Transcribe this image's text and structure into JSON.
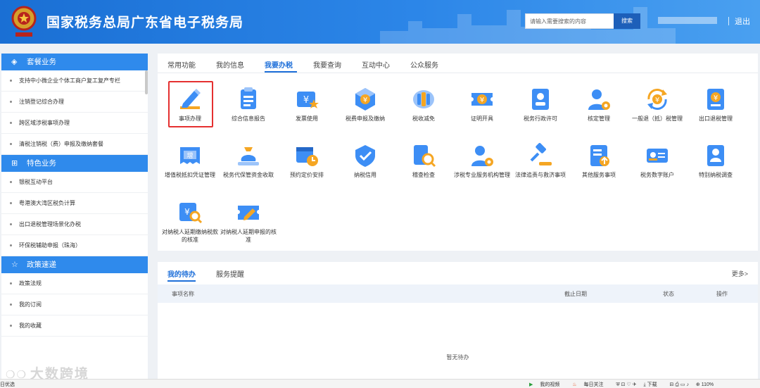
{
  "header": {
    "title": "国家税务总局广东省电子税务局",
    "search_placeholder": "请输入需要搜索的内容",
    "search_button": "搜索",
    "logout": "退出"
  },
  "sidebar": {
    "sections": [
      {
        "title": "套餐业务",
        "icon": "cube-icon",
        "items": [
          "支持中小微企业个体工商户复工复产专栏",
          "注销登记综合办理",
          "跨区域涉税事项办理",
          "清税注销税（费）申报及缴纳套餐"
        ]
      },
      {
        "title": "特色业务",
        "icon": "grid-icon",
        "items": [
          "银税互动平台",
          "粤港澳大湾区税负计算",
          "出口退税管理场景化办税",
          "环保税辅助申报（珠海）"
        ]
      },
      {
        "title": "政策速递",
        "icon": "star-icon",
        "items": [
          "政策法规",
          "我的订阅",
          "我的收藏"
        ]
      }
    ]
  },
  "tabs": [
    "常用功能",
    "我的信息",
    "我要办税",
    "我要查询",
    "互动中心",
    "公众服务"
  ],
  "active_tab": "我要办税",
  "services": [
    {
      "label": "事项办理",
      "icon": "pencil-icon"
    },
    {
      "label": "综合信息报告",
      "icon": "document-list-icon"
    },
    {
      "label": "发票使用",
      "icon": "invoice-star-icon"
    },
    {
      "label": "税费申报及缴纳",
      "icon": "yuan-cube-icon"
    },
    {
      "label": "税收减免",
      "icon": "coin-stack-icon"
    },
    {
      "label": "证明开具",
      "icon": "yuan-ticket-icon"
    },
    {
      "label": "税务行政许可",
      "icon": "id-badge-icon"
    },
    {
      "label": "核定管理",
      "icon": "user-gear-icon"
    },
    {
      "label": "一般退（抵）税管理",
      "icon": "yuan-refresh-icon"
    },
    {
      "label": "出口退税管理",
      "icon": "export-doc-icon"
    },
    {
      "label": "增值税抵扣凭证管理",
      "icon": "receipt-icon"
    },
    {
      "label": "税务代保管资金收取",
      "icon": "money-bag-icon"
    },
    {
      "label": "预约定价安排",
      "icon": "calendar-clock-icon"
    },
    {
      "label": "纳税信用",
      "icon": "shield-check-icon"
    },
    {
      "label": "稽查检查",
      "icon": "doc-search-icon"
    },
    {
      "label": "涉税专业服务机构管理",
      "icon": "user-gear-icon"
    },
    {
      "label": "法律追责与救济事项",
      "icon": "gavel-icon"
    },
    {
      "label": "其他服务事项",
      "icon": "list-up-icon"
    },
    {
      "label": "税务数字账户",
      "icon": "id-card-icon"
    },
    {
      "label": "特别纳税调查",
      "icon": "person-doc-icon"
    },
    {
      "label": "对纳税人延期缴纳税款的核准",
      "icon": "yuan-search-icon"
    },
    {
      "label": "对纳税人延期申报的核准",
      "icon": "ticket-edit-icon"
    }
  ],
  "pending": {
    "tabs": [
      "我的待办",
      "服务提醒"
    ],
    "more": "更多>",
    "columns": [
      "事项名称",
      "截止日期",
      "状态",
      "操作"
    ],
    "empty_text": "暂无待办"
  },
  "statusbar": {
    "left": "日优选",
    "items": [
      "我的视频",
      "每日关注",
      "下载",
      "110%"
    ]
  },
  "watermark": "大数跨境",
  "colors": {
    "primary": "#1e6fd9",
    "header": "#2c86e8",
    "highlight": "#e53030",
    "icon_blue": "#3d8ef5",
    "icon_orange": "#f5a623"
  }
}
